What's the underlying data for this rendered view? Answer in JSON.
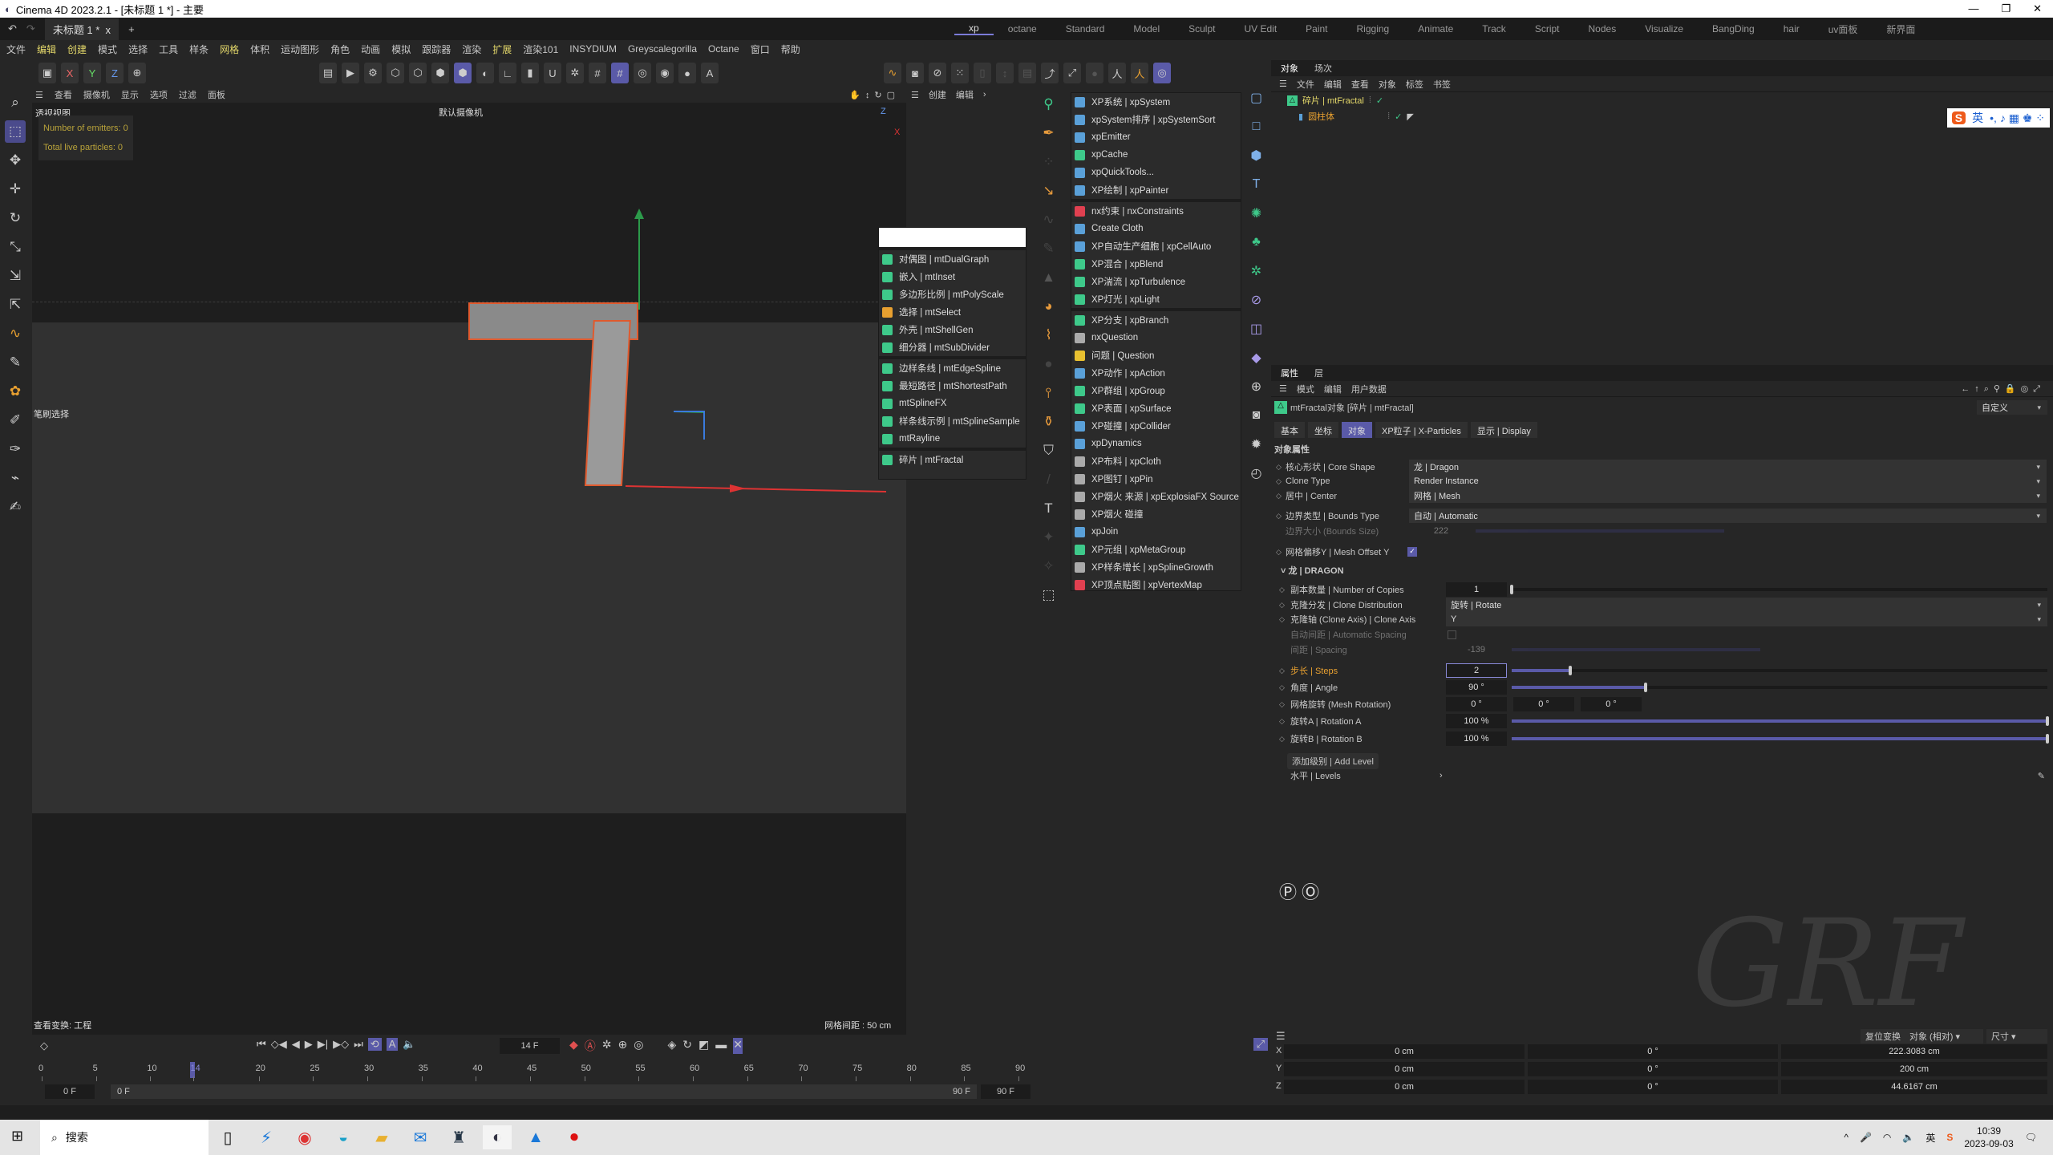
{
  "window": {
    "title": "Cinema 4D 2023.2.1 - [未标题 1 *] - 主要",
    "doc_tab": "未标题 1 *"
  },
  "layouts": [
    "xp",
    "octane",
    "Standard",
    "Model",
    "Sculpt",
    "UV Edit",
    "Paint",
    "Rigging",
    "Animate",
    "Track",
    "Script",
    "Nodes",
    "Visualize",
    "BangDing",
    "hair",
    "uv面板",
    "新界面"
  ],
  "menu": [
    "文件",
    "编辑",
    "创建",
    "模式",
    "选择",
    "工具",
    "样条",
    "网格",
    "体积",
    "运动图形",
    "角色",
    "动画",
    "模拟",
    "跟踪器",
    "渲染",
    "扩展",
    "渲染101",
    "INSYDIUM",
    "Greyscalegorilla",
    "Octane",
    "窗口",
    "帮助"
  ],
  "viewport": {
    "menu": [
      "查看",
      "摄像机",
      "显示",
      "选项",
      "过滤",
      "面板"
    ],
    "title": "透视视图",
    "camera": "默认摄像机",
    "hud": [
      "Number of emitters: 0",
      "Total live particles: 0"
    ],
    "brush": "笔刷选择",
    "status_left": "查看变换: 工程",
    "grid": "网格间距 : 50 cm"
  },
  "mid_menu": [
    "创建",
    "编辑"
  ],
  "mt_menu": [
    {
      "label": "对偶图 | mtDualGraph",
      "color": "#3ec98a"
    },
    {
      "label": "嵌入 | mtInset",
      "color": "#3ec98a"
    },
    {
      "label": "多边形比例 | mtPolyScale",
      "color": "#3ec98a"
    },
    {
      "label": "选择 | mtSelect",
      "color": "#e8a030"
    },
    {
      "label": "外壳 | mtShellGen",
      "color": "#3ec98a"
    },
    {
      "label": "细分器 | mtSubDivider",
      "color": "#3ec98a"
    },
    {
      "sep": true
    },
    {
      "label": "边样条线 | mtEdgeSpline",
      "color": "#3ec98a"
    },
    {
      "label": "最短路径 | mtShortestPath",
      "color": "#3ec98a"
    },
    {
      "label": "mtSplineFX",
      "color": "#3ec98a"
    },
    {
      "label": "样条线示例 | mtSplineSample",
      "color": "#3ec98a"
    },
    {
      "label": "mtRayline",
      "color": "#3ec98a"
    },
    {
      "sep": true
    },
    {
      "label": "碎片 | mtFractal",
      "color": "#3ec98a"
    }
  ],
  "xp_menu": [
    {
      "label": "XP系统 | xpSystem",
      "color": "#5aa0d8"
    },
    {
      "label": "xpSystem排序 | xpSystemSort",
      "color": "#5aa0d8"
    },
    {
      "label": "xpEmitter",
      "color": "#5aa0d8"
    },
    {
      "label": "xpCache",
      "color": "#3ec98a"
    },
    {
      "label": "xpQuickTools...",
      "color": "#5aa0d8"
    },
    {
      "label": "XP绘制 | xpPainter",
      "color": "#5aa0d8"
    },
    {
      "sep": true
    },
    {
      "label": "nx约束 | nxConstraints",
      "color": "#e04050"
    },
    {
      "label": "Create Cloth",
      "color": "#5aa0d8"
    },
    {
      "label": "XP自动生产细胞 | xpCellAuto",
      "color": "#5aa0d8"
    },
    {
      "label": "XP混合 | xpBlend",
      "color": "#3ec98a"
    },
    {
      "label": "XP湍流 | xpTurbulence",
      "color": "#3ec98a"
    },
    {
      "label": "XP灯光 | xpLight",
      "color": "#3ec98a"
    },
    {
      "sep": true
    },
    {
      "label": "XP分支 | xpBranch",
      "color": "#3ec98a"
    },
    {
      "label": "nxQuestion",
      "color": "#aaaaaa"
    },
    {
      "label": "问题 | Question",
      "color": "#e8c030"
    },
    {
      "label": "XP动作 | xpAction",
      "color": "#5aa0d8"
    },
    {
      "label": "XP群组 | xpGroup",
      "color": "#3ec98a"
    },
    {
      "label": "XP表面 | xpSurface",
      "color": "#3ec98a"
    },
    {
      "label": "XP碰撞 | xpCollider",
      "color": "#5aa0d8"
    },
    {
      "label": "xpDynamics",
      "color": "#5aa0d8"
    },
    {
      "label": "XP布料 | xpCloth",
      "color": "#aaaaaa"
    },
    {
      "label": "XP图钉 | xpPin",
      "color": "#aaaaaa"
    },
    {
      "label": "XP烟火 来源 | xpExplosiaFX Source",
      "color": "#aaaaaa"
    },
    {
      "label": "XP烟火 碰撞",
      "color": "#aaaaaa"
    },
    {
      "label": "xpJoin",
      "color": "#5aa0d8"
    },
    {
      "label": "XP元组 | xpMetaGroup",
      "color": "#3ec98a"
    },
    {
      "label": "XP样条增长 | xpSplineGrowth",
      "color": "#aaaaaa"
    },
    {
      "label": "XP顶点贴图 | xpVertexMap",
      "color": "#e04050"
    }
  ],
  "objects": {
    "tabs": [
      "对象",
      "场次"
    ],
    "menu": [
      "文件",
      "编辑",
      "查看",
      "对象",
      "标签",
      "书签"
    ],
    "items": [
      {
        "name": "碎片 | mtFractal",
        "color": "#e4d86a"
      },
      {
        "name": "圆柱体",
        "color": "#e8a030"
      }
    ],
    "ime": [
      "S",
      "英"
    ]
  },
  "attributes": {
    "tabs": [
      "属性",
      "层"
    ],
    "menu": [
      "模式",
      "编辑",
      "用户数据"
    ],
    "object_title": "mtFractal对象 [碎片 | mtFractal]",
    "preset": "自定义",
    "subtabs": [
      "基本",
      "坐标",
      "对象",
      "XP粒子 | X-Particles",
      "显示 | Display"
    ],
    "active_subtab": 2,
    "section": "对象属性",
    "core_shape": {
      "label": "核心形状 | Core Shape",
      "value": "龙 | Dragon"
    },
    "clone_type": {
      "label": "Clone Type",
      "value": "Render Instance"
    },
    "center": {
      "label": "居中 | Center",
      "value": "网格 | Mesh"
    },
    "bounds_type": {
      "label": "边界类型 | Bounds Type",
      "value": "自动 | Automatic"
    },
    "bounds_size": {
      "label": "边界大小 (Bounds Size)",
      "value": "222"
    },
    "mesh_offset": {
      "label": "网格偏移Y | Mesh Offset Y",
      "checked": true
    },
    "dragon": "龙 | DRAGON",
    "copies": {
      "label": "副本数量 | Number of Copies",
      "value": "1",
      "fraction": 0
    },
    "distribution": {
      "label": "克隆分发 | Clone Distribution",
      "value": "旋转 | Rotate"
    },
    "axis": {
      "label": "克隆轴 (Clone Axis) | Clone Axis",
      "value": "Y"
    },
    "auto_spacing": {
      "label": "自动间距 | Automatic Spacing",
      "checked": false
    },
    "spacing": {
      "label": "间距 | Spacing",
      "value": "-139"
    },
    "steps": {
      "label": "步长 | Steps",
      "value": "2",
      "fraction": 0.11
    },
    "angle": {
      "label": "角度 | Angle",
      "value": "90 °",
      "fraction": 0.25
    },
    "mesh_rotation": {
      "label": "网格旋转 (Mesh Rotation)",
      "values": [
        "0 °",
        "0 °",
        "0 °"
      ]
    },
    "rot_a": {
      "label": "旋转A | Rotation A",
      "value": "100 %",
      "fraction": 1
    },
    "rot_b": {
      "label": "旋转B | Rotation B",
      "value": "100 %",
      "fraction": 1
    },
    "add_level": "添加级别 | Add Level",
    "levels": "水平 | Levels"
  },
  "coords": {
    "reset": "复位变换",
    "mode": "对象 (相对)",
    "size_mode": "尺寸",
    "rows": [
      {
        "axis": "X",
        "pos": "0 cm",
        "rot": "0 °",
        "size": "222.3083 cm"
      },
      {
        "axis": "Y",
        "pos": "0 cm",
        "rot": "0 °",
        "size": "200 cm"
      },
      {
        "axis": "Z",
        "pos": "0 cm",
        "rot": "0 °",
        "size": "44.6167 cm"
      }
    ]
  },
  "timeline": {
    "current_frame": "14 F",
    "current": 14,
    "ticks": [
      "0",
      "5",
      "10",
      "14",
      "20",
      "25",
      "30",
      "35",
      "40",
      "45",
      "50",
      "55",
      "60",
      "65",
      "70",
      "75",
      "80",
      "85",
      "90"
    ],
    "start": "0 F",
    "range_start": "0 F",
    "range_end": "90 F",
    "end": "90 F"
  },
  "taskbar": {
    "search": "搜索",
    "ime": "英",
    "time": "10:39",
    "date": "2023-09-03"
  },
  "watermark": "GRF"
}
